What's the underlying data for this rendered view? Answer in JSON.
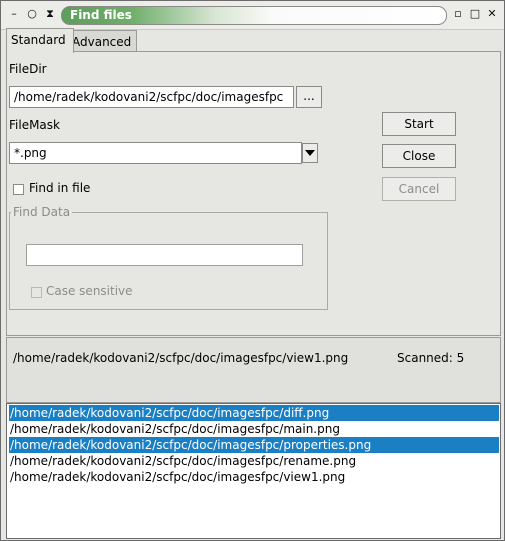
{
  "window": {
    "title": "Find files",
    "controls": {
      "menu": "–",
      "restore": "○",
      "shade": "⧗",
      "minimize": "▫",
      "maximize": "□",
      "close": "✕"
    }
  },
  "tabs": [
    {
      "label": "Standard",
      "active": true
    },
    {
      "label": "Advanced",
      "active": false
    }
  ],
  "form": {
    "filedir_label": "FileDir",
    "filedir_value": "/home/radek/kodovani2/scfpc/doc/imagesfpc",
    "browse_label": "...",
    "filemask_label": "FileMask",
    "filemask_value": "*.png",
    "find_in_file_label": "Find in file",
    "find_data_group": "Find Data",
    "find_data_value": "",
    "case_sensitive_label": "Case sensitive"
  },
  "buttons": {
    "start": "Start",
    "close": "Close",
    "cancel": "Cancel"
  },
  "status": {
    "current_path": "/home/radek/kodovani2/scfpc/doc/imagesfpc/view1.png",
    "scanned": "Scanned: 5"
  },
  "results": [
    {
      "path": "/home/radek/kodovani2/scfpc/doc/imagesfpc/diff.png",
      "selected": true
    },
    {
      "path": "/home/radek/kodovani2/scfpc/doc/imagesfpc/main.png",
      "selected": false
    },
    {
      "path": "/home/radek/kodovani2/scfpc/doc/imagesfpc/properties.png",
      "selected": true
    },
    {
      "path": "/home/radek/kodovani2/scfpc/doc/imagesfpc/rename.png",
      "selected": false
    },
    {
      "path": "/home/radek/kodovani2/scfpc/doc/imagesfpc/view1.png",
      "selected": false
    }
  ],
  "colors": {
    "selection": "#1b7fc4",
    "title_green": "#5f9d5d",
    "window_bg": "#e6e6e3"
  }
}
